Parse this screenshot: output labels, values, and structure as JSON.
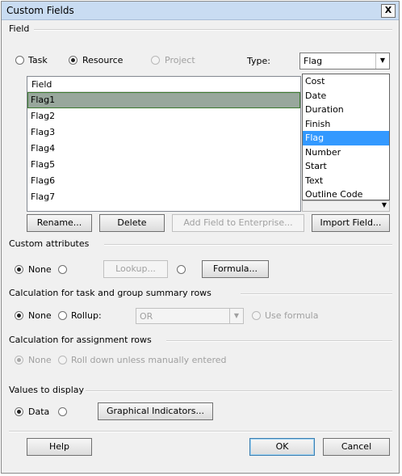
{
  "window": {
    "title": "Custom Fields",
    "close_glyph": "X"
  },
  "field_group": {
    "label": "Field",
    "radios": [
      {
        "label": "Task",
        "selected": false,
        "enabled": true
      },
      {
        "label": "Resource",
        "selected": true,
        "enabled": true
      },
      {
        "label": "Project",
        "selected": false,
        "enabled": false
      }
    ],
    "type_label": "Type:",
    "type_value": "Flag"
  },
  "field_list": {
    "header": "Field",
    "items": [
      "Flag1",
      "Flag2",
      "Flag3",
      "Flag4",
      "Flag5",
      "Flag6",
      "Flag7"
    ],
    "selected": "Flag1"
  },
  "type_dropdown": {
    "options": [
      "Cost",
      "Date",
      "Duration",
      "Finish",
      "Flag",
      "Number",
      "Start",
      "Text",
      "Outline Code"
    ],
    "highlighted": "Flag"
  },
  "field_buttons": {
    "rename": "Rename...",
    "delete": "Delete",
    "add_enterprise": "Add Field to Enterprise...",
    "import": "Import Field..."
  },
  "custom_attributes": {
    "label": "Custom attributes",
    "none": "None",
    "lookup": "Lookup...",
    "formula": "Formula..."
  },
  "calc_summary": {
    "label": "Calculation for task and group summary rows",
    "none": "None",
    "rollup": "Rollup:",
    "rollup_value": "OR",
    "use_formula": "Use formula"
  },
  "calc_assignment": {
    "label": "Calculation for assignment rows",
    "none": "None",
    "roll_down": "Roll down unless manually entered"
  },
  "values_display": {
    "label": "Values to display",
    "data": "Data",
    "graphical": "Graphical Indicators..."
  },
  "footer": {
    "help": "Help",
    "ok": "OK",
    "cancel": "Cancel"
  },
  "colors": {
    "title_bar": "#c9dcf2",
    "selected_row": "#98a79c",
    "highlight": "#3399ff"
  }
}
